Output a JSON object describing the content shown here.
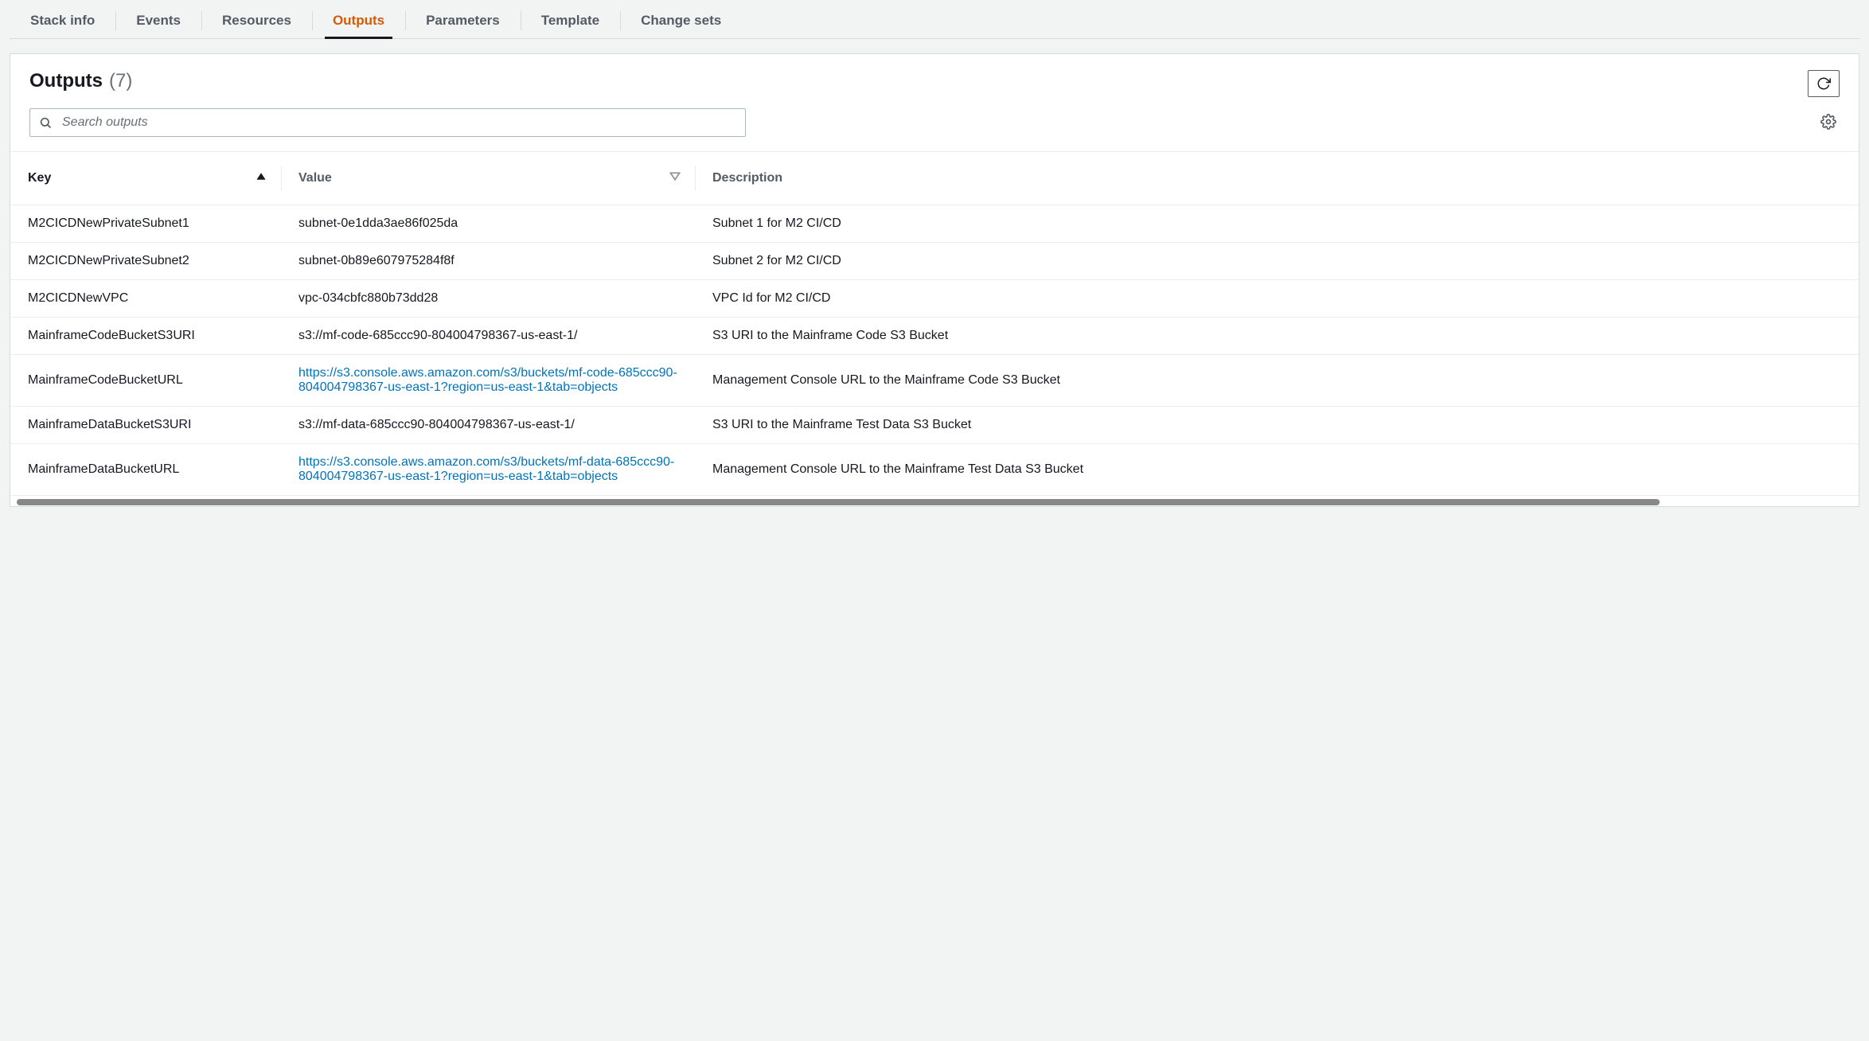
{
  "tabs": [
    {
      "id": "stackinfo",
      "label": "Stack info"
    },
    {
      "id": "events",
      "label": "Events"
    },
    {
      "id": "resources",
      "label": "Resources"
    },
    {
      "id": "outputs",
      "label": "Outputs",
      "active": true
    },
    {
      "id": "parameters",
      "label": "Parameters"
    },
    {
      "id": "template",
      "label": "Template"
    },
    {
      "id": "changesets",
      "label": "Change sets"
    }
  ],
  "panel": {
    "title": "Outputs",
    "count": "(7)"
  },
  "search": {
    "placeholder": "Search outputs"
  },
  "columns": {
    "key": "Key",
    "value": "Value",
    "description": "Description"
  },
  "sort": {
    "column": "key",
    "direction": "asc"
  },
  "rows": [
    {
      "key": "M2CICDNewPrivateSubnet1",
      "value": "subnet-0e1dda3ae86f025da",
      "is_link": false,
      "description": "Subnet 1 for M2 CI/CD"
    },
    {
      "key": "M2CICDNewPrivateSubnet2",
      "value": "subnet-0b89e607975284f8f",
      "is_link": false,
      "description": "Subnet 2 for M2 CI/CD"
    },
    {
      "key": "M2CICDNewVPC",
      "value": "vpc-034cbfc880b73dd28",
      "is_link": false,
      "description": "VPC Id for M2 CI/CD"
    },
    {
      "key": "MainframeCodeBucketS3URI",
      "value": "s3://mf-code-685ccc90-804004798367-us-east-1/",
      "is_link": false,
      "description": "S3 URI to the Mainframe Code S3 Bucket"
    },
    {
      "key": "MainframeCodeBucketURL",
      "value": "https://s3.console.aws.amazon.com/s3/buckets/mf-code-685ccc90-804004798367-us-east-1?region=us-east-1&tab=objects",
      "is_link": true,
      "description": "Management Console URL to the Mainframe Code S3 Bucket"
    },
    {
      "key": "MainframeDataBucketS3URI",
      "value": "s3://mf-data-685ccc90-804004798367-us-east-1/",
      "is_link": false,
      "description": "S3 URI to the Mainframe Test Data S3 Bucket"
    },
    {
      "key": "MainframeDataBucketURL",
      "value": "https://s3.console.aws.amazon.com/s3/buckets/mf-data-685ccc90-804004798367-us-east-1?region=us-east-1&tab=objects",
      "is_link": true,
      "description": "Management Console URL to the Mainframe Test Data S3 Bucket"
    }
  ]
}
